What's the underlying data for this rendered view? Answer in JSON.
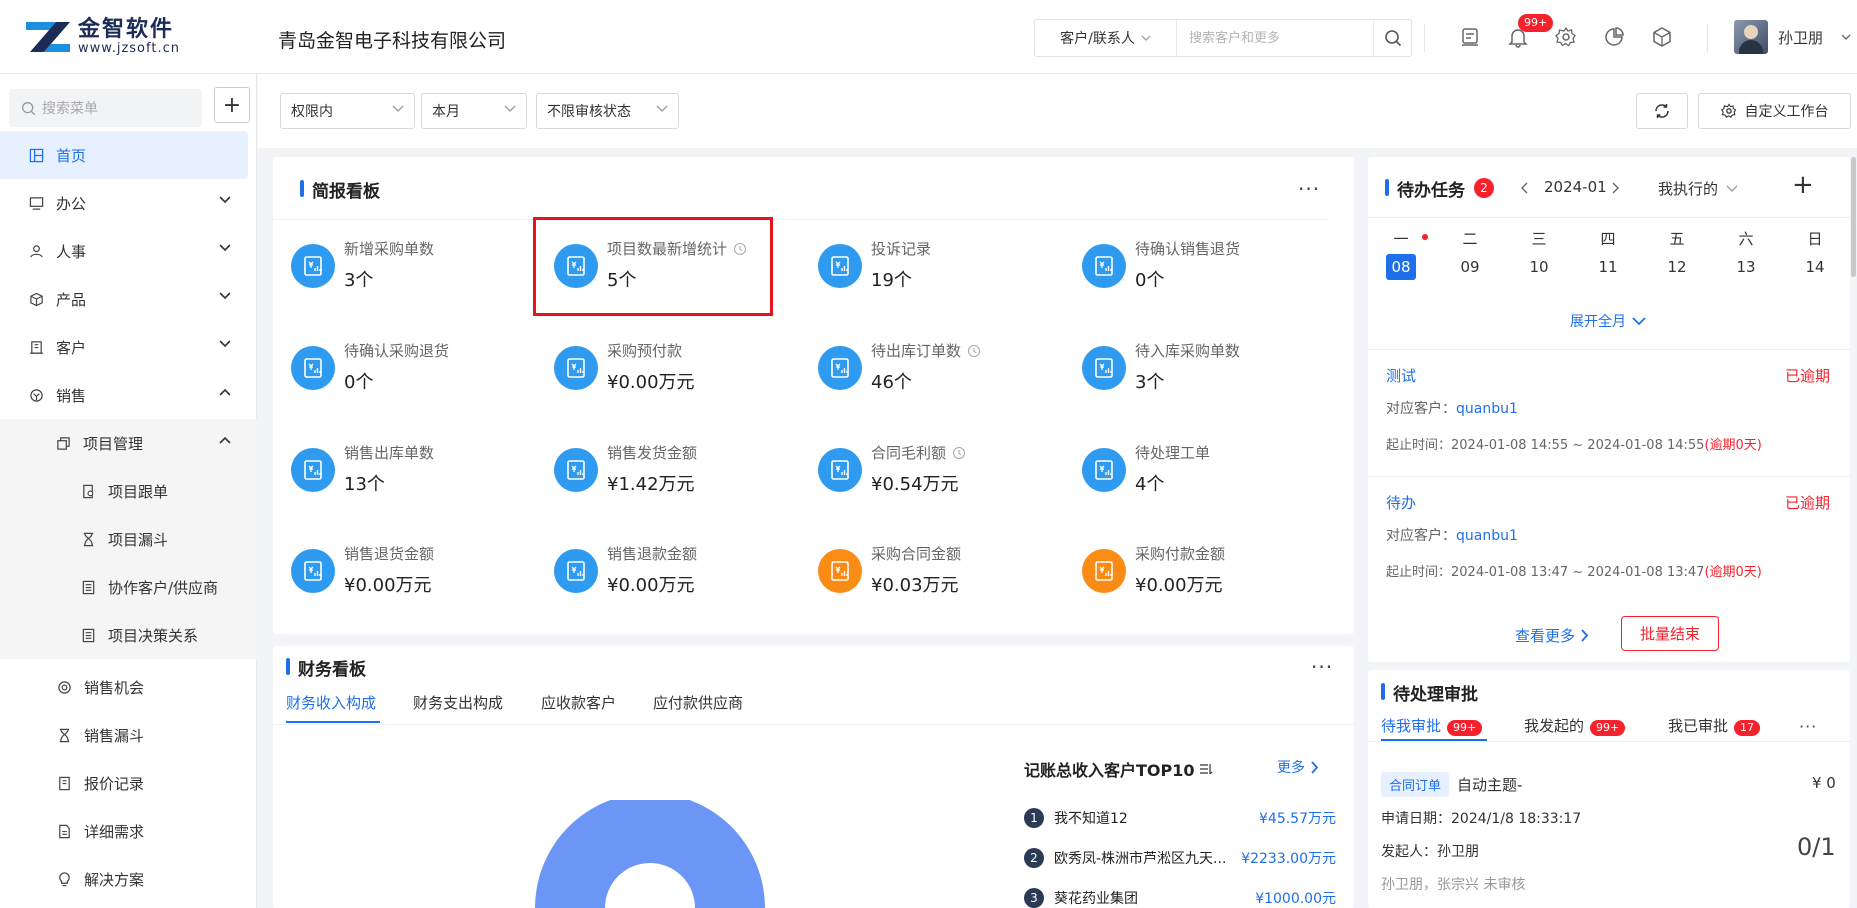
{
  "header": {
    "logo_name": "金智软件",
    "logo_url": "www.jzsoft.cn",
    "company": "青岛金智电子科技有限公司",
    "search_type": "客户/联系人",
    "search_placeholder": "搜索客户和更多",
    "notify_badge": "99+",
    "user_name": "孙卫朋"
  },
  "sidebar": {
    "search_placeholder": "搜索菜单",
    "items": [
      {
        "label": "首页"
      },
      {
        "label": "办公"
      },
      {
        "label": "人事"
      },
      {
        "label": "产品"
      },
      {
        "label": "客户"
      },
      {
        "label": "销售"
      },
      {
        "label": "项目管理"
      },
      {
        "label": "项目跟单"
      },
      {
        "label": "项目漏斗"
      },
      {
        "label": "协作客户/供应商"
      },
      {
        "label": "项目决策关系"
      },
      {
        "label": "销售机会"
      },
      {
        "label": "销售漏斗"
      },
      {
        "label": "报价记录"
      },
      {
        "label": "详细需求"
      },
      {
        "label": "解决方案"
      }
    ]
  },
  "filters": {
    "scope": "权限内",
    "period": "本月",
    "audit": "不限审核状态",
    "custom_label": "自定义工作台"
  },
  "brief": {
    "title": "简报看板",
    "stats": [
      {
        "label": "新增采购单数",
        "value": "3个"
      },
      {
        "label": "项目数最新增统计",
        "value": "5个"
      },
      {
        "label": "投诉记录",
        "value": "19个"
      },
      {
        "label": "待确认销售退货",
        "value": "0个"
      },
      {
        "label": "待确认采购退货",
        "value": "0个"
      },
      {
        "label": "采购预付款",
        "value": "¥0.00万元"
      },
      {
        "label": "待出库订单数",
        "value": "46个"
      },
      {
        "label": "待入库采购单数",
        "value": "3个"
      },
      {
        "label": "销售出库单数",
        "value": "13个"
      },
      {
        "label": "销售发货金额",
        "value": "¥1.42万元"
      },
      {
        "label": "合同毛利额",
        "value": "¥0.54万元"
      },
      {
        "label": "待处理工单",
        "value": "4个"
      },
      {
        "label": "销售退货金额",
        "value": "¥0.00万元"
      },
      {
        "label": "销售退款金额",
        "value": "¥0.00万元"
      },
      {
        "label": "采购合同金额",
        "value": "¥0.03万元"
      },
      {
        "label": "采购付款金额",
        "value": "¥0.00万元"
      }
    ]
  },
  "todo": {
    "title": "待办任务",
    "count": "2",
    "month": "2024-01",
    "filter": "我执行的",
    "weekdays": [
      "一",
      "二",
      "三",
      "四",
      "五",
      "六",
      "日"
    ],
    "dates": [
      "08",
      "09",
      "10",
      "11",
      "12",
      "13",
      "14"
    ],
    "expand": "展开全月",
    "tasks": [
      {
        "name": "测试",
        "status": "已逾期",
        "customer_label": "对应客户：",
        "customer": "quanbu1",
        "time": "起止时间：2024-01-08 14:55 ~ 2024-01-08 14:55",
        "overdue": "(逾期0天)"
      },
      {
        "name": "待办",
        "status": "已逾期",
        "customer_label": "对应客户：",
        "customer": "quanbu1",
        "time": "起止时间：2024-01-08 13:47 ~ 2024-01-08 13:47",
        "overdue": "(逾期0天)"
      }
    ],
    "view_more": "查看更多",
    "batch_end": "批量结束"
  },
  "finance": {
    "title": "财务看板",
    "tabs": [
      "财务收入构成",
      "财务支出构成",
      "应收款客户",
      "应付款供应商"
    ],
    "top_title": "记账总收入客户TOP10",
    "more": "更多",
    "top": [
      {
        "rank": "1",
        "name": "我不知道12",
        "value": "¥45.57万元"
      },
      {
        "rank": "2",
        "name": "欧秀凤-株洲市芦淞区九天...",
        "value": "¥2233.00万元"
      },
      {
        "rank": "3",
        "name": "葵花药业集团",
        "value": "¥1000.00元"
      }
    ]
  },
  "approval": {
    "title": "待处理审批",
    "tabs": [
      {
        "label": "待我审批",
        "badge": "99+"
      },
      {
        "label": "我发起的",
        "badge": "99+"
      },
      {
        "label": "我已审批",
        "badge": "17"
      }
    ],
    "item": {
      "tag": "合同订单",
      "subject": "自动主题-",
      "amount": "¥ 0",
      "date": "申请日期：2024/1/8 18:33:17",
      "initiator": "发起人：孙卫朋",
      "progress": "0/1",
      "reviewers": "孙卫朋，张宗兴 未审核"
    }
  }
}
